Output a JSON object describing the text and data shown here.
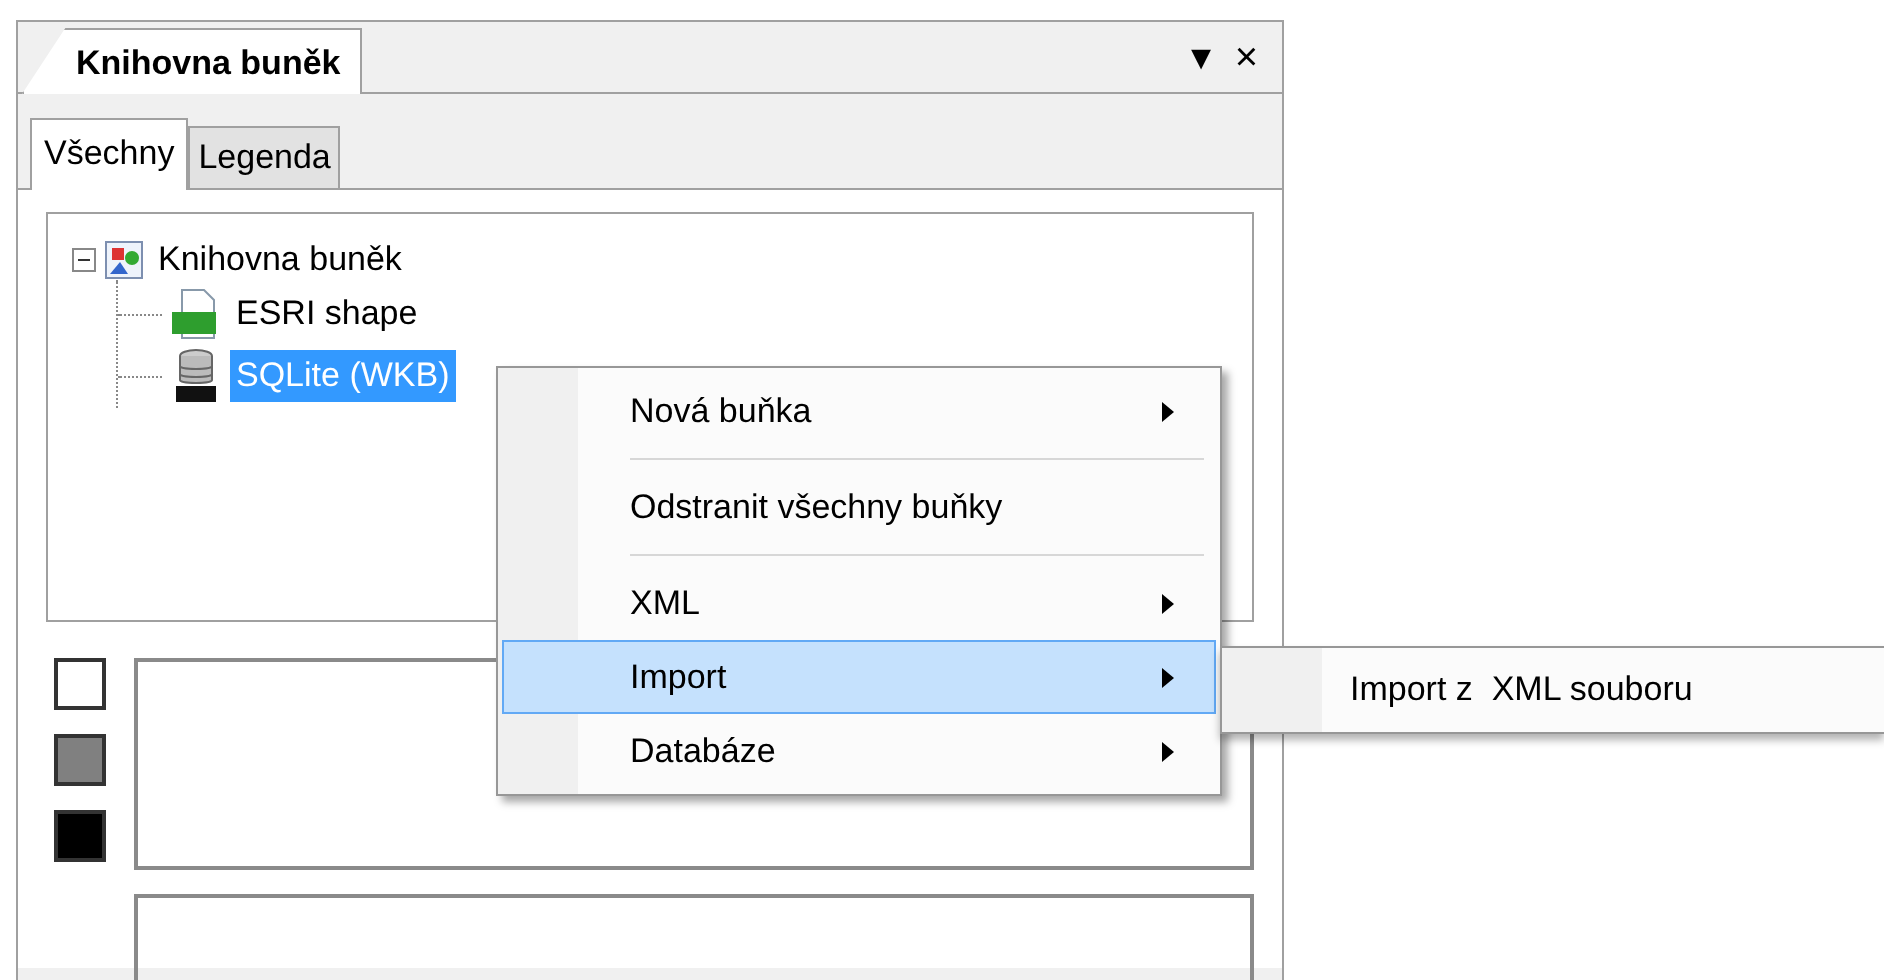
{
  "panel": {
    "title": "Knihovna buněk",
    "dropdown_glyph": "▾",
    "close_glyph": "×"
  },
  "tabs": [
    {
      "label": "Všechny",
      "selected": true
    },
    {
      "label": "Legenda",
      "selected": false
    }
  ],
  "tree": [
    {
      "label": "Knihovna buněk",
      "kind": "library",
      "expanded": true,
      "selected": false,
      "children": [
        {
          "label": "ESRI shape",
          "kind": "shp",
          "selected": false
        },
        {
          "label": "SQLite (WKB)",
          "kind": "lite",
          "selected": true
        }
      ]
    }
  ],
  "swatches": [
    {
      "color": "#ffffff"
    },
    {
      "color": "#808080"
    },
    {
      "color": "#000000"
    }
  ],
  "context_menu": [
    {
      "kind": "submenu",
      "label": "Nová buňka",
      "selected": false
    },
    {
      "kind": "separator"
    },
    {
      "kind": "item",
      "label": "Odstranit všechny buňky",
      "selected": false
    },
    {
      "kind": "separator"
    },
    {
      "kind": "submenu",
      "label": "XML",
      "selected": false
    },
    {
      "kind": "submenu",
      "label": "Import",
      "selected": true
    },
    {
      "kind": "submenu",
      "label": "Databáze",
      "selected": false
    }
  ],
  "submenu": [
    {
      "label": "Import z  XML souboru"
    }
  ]
}
